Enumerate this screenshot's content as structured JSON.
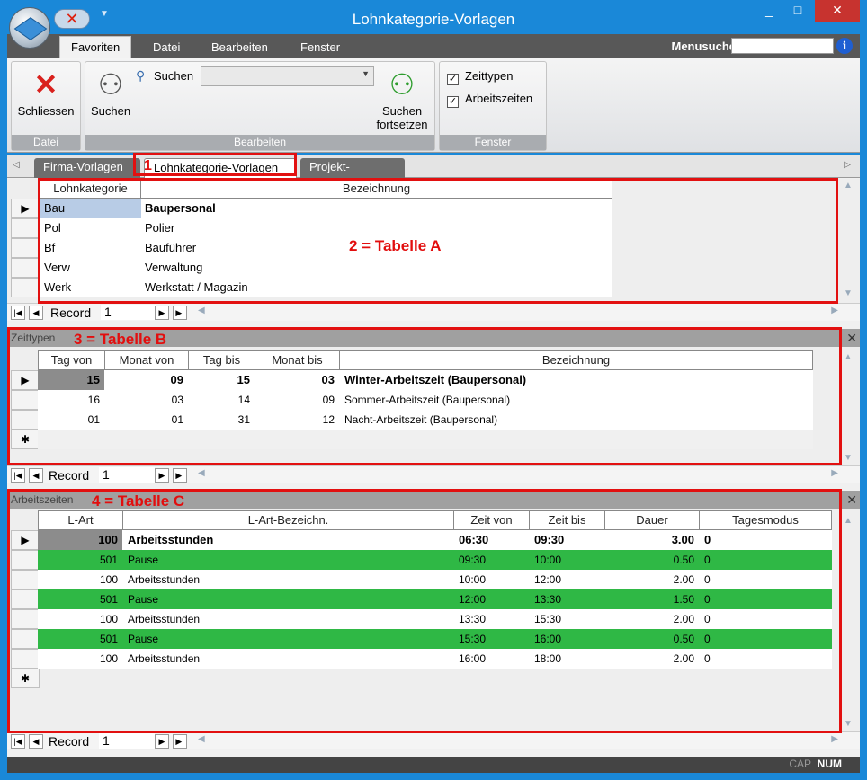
{
  "window": {
    "title": "Lohnkategorie-Vorlagen",
    "minimize": "_",
    "maximize": "□",
    "close": "✕"
  },
  "menu": {
    "tabs": [
      "Favoriten",
      "Datei",
      "Bearbeiten",
      "Fenster"
    ],
    "search_label": "Menusuche",
    "info": "i"
  },
  "ribbon": {
    "close_label": "Schliessen",
    "search_small_label": "Suchen",
    "search_label": "Suchen",
    "search_continue_label": "Suchen fortsetzen",
    "group_datei": "Datei",
    "group_bearbeiten": "Bearbeiten",
    "group_fenster": "Fenster",
    "check_zeittypen": "Zeittypen",
    "check_arbeitszeiten": "Arbeitszeiten"
  },
  "doc_tabs": [
    "Firma-Vorlagen",
    "Lohnkategorie-Vorlagen",
    "Projekt-Vorlagen"
  ],
  "tab_annot": "1",
  "table_a": {
    "annot": "2 = Tabelle A",
    "headers": [
      "Lohnkategorie",
      "Bezeichnung"
    ],
    "rows": [
      [
        "Bau",
        "Baupersonal"
      ],
      [
        "Pol",
        "Polier"
      ],
      [
        "Bf",
        "Bauführer"
      ],
      [
        "Verw",
        "Verwaltung"
      ],
      [
        "Werk",
        "Werkstatt / Magazin"
      ]
    ]
  },
  "table_b": {
    "title": "Zeittypen",
    "annot": "3 = Tabelle B",
    "headers": [
      "Tag von",
      "Monat von",
      "Tag bis",
      "Monat bis",
      "Bezeichnung"
    ],
    "rows": [
      [
        "15",
        "09",
        "15",
        "03",
        "Winter-Arbeitszeit (Baupersonal)"
      ],
      [
        "16",
        "03",
        "14",
        "09",
        "Sommer-Arbeitszeit (Baupersonal)"
      ],
      [
        "01",
        "01",
        "31",
        "12",
        "Nacht-Arbeitszeit (Baupersonal)"
      ]
    ]
  },
  "table_c": {
    "title": "Arbeitszeiten",
    "annot": "4 = Tabelle C",
    "headers": [
      "L-Art",
      "L-Art-Bezeichn.",
      "Zeit von",
      "Zeit bis",
      "Dauer",
      "Tagesmodus"
    ],
    "rows": [
      [
        "100",
        "Arbeitsstunden",
        "06:30",
        "09:30",
        "3.00",
        "0"
      ],
      [
        "501",
        "Pause",
        "09:30",
        "10:00",
        "0.50",
        "0"
      ],
      [
        "100",
        "Arbeitsstunden",
        "10:00",
        "12:00",
        "2.00",
        "0"
      ],
      [
        "501",
        "Pause",
        "12:00",
        "13:30",
        "1.50",
        "0"
      ],
      [
        "100",
        "Arbeitsstunden",
        "13:30",
        "15:30",
        "2.00",
        "0"
      ],
      [
        "501",
        "Pause",
        "15:30",
        "16:00",
        "0.50",
        "0"
      ],
      [
        "100",
        "Arbeitsstunden",
        "16:00",
        "18:00",
        "2.00",
        "0"
      ]
    ]
  },
  "record_nav": {
    "label": "Record",
    "value": "1"
  },
  "status": {
    "cap": "CAP",
    "num": "NUM"
  }
}
